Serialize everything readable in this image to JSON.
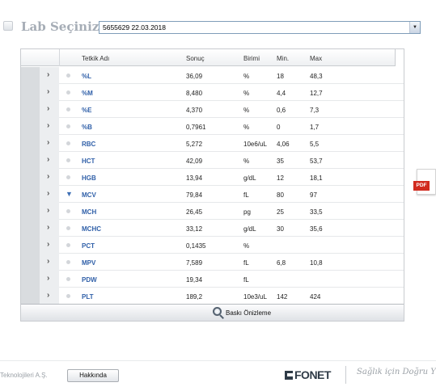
{
  "header": {
    "title": "Lab Seçiniz",
    "lab_value": "5655629 22.03.2018"
  },
  "table": {
    "columns": {
      "name": "Tetkik Adı",
      "result": "Sonuç",
      "unit": "Birimi",
      "min": "Min.",
      "max": "Max"
    },
    "rows": [
      {
        "name": "%L",
        "result": "36,09",
        "unit": "%",
        "min": "18",
        "max": "48,3",
        "flag": ""
      },
      {
        "name": "%M",
        "result": "8,480",
        "unit": "%",
        "min": "4,4",
        "max": "12,7",
        "flag": ""
      },
      {
        "name": "%E",
        "result": "4,370",
        "unit": "%",
        "min": "0,6",
        "max": "7,3",
        "flag": ""
      },
      {
        "name": "%B",
        "result": "0,7961",
        "unit": "%",
        "min": "0",
        "max": "1,7",
        "flag": ""
      },
      {
        "name": "RBC",
        "result": "5,272",
        "unit": "10e6/uL",
        "min": "4,06",
        "max": "5,5",
        "flag": ""
      },
      {
        "name": "HCT",
        "result": "42,09",
        "unit": "%",
        "min": "35",
        "max": "53,7",
        "flag": ""
      },
      {
        "name": "HGB",
        "result": "13,94",
        "unit": "g/dL",
        "min": "12",
        "max": "18,1",
        "flag": ""
      },
      {
        "name": "MCV",
        "result": "79,84",
        "unit": "fL",
        "min": "80",
        "max": "97",
        "flag": "low"
      },
      {
        "name": "MCH",
        "result": "26,45",
        "unit": "pg",
        "min": "25",
        "max": "33,5",
        "flag": ""
      },
      {
        "name": "MCHC",
        "result": "33,12",
        "unit": "g/dL",
        "min": "30",
        "max": "35,6",
        "flag": ""
      },
      {
        "name": "PCT",
        "result": "0,1435",
        "unit": "%",
        "min": "",
        "max": "",
        "flag": ""
      },
      {
        "name": "MPV",
        "result": "7,589",
        "unit": "fL",
        "min": "6,8",
        "max": "10,8",
        "flag": ""
      },
      {
        "name": "PDW",
        "result": "19,34",
        "unit": "fL",
        "min": "",
        "max": "",
        "flag": ""
      },
      {
        "name": "PLT",
        "result": "189,2",
        "unit": "10e3/uL",
        "min": "142",
        "max": "424",
        "flag": ""
      }
    ],
    "print_preview_label": "Baskı Önizleme"
  },
  "pdf_label": "PDF",
  "footer": {
    "company": "Teknolojileri A.Ş.",
    "about_label": "Hakkında",
    "brand": "FONET",
    "slogan": "Sağlık için Doğru Y"
  },
  "icons": {
    "expand": "chevron-right-icon",
    "abnormal": "triangle-down-icon",
    "print": "magnifier-icon",
    "pdf": "pdf-file-icon"
  },
  "colors": {
    "link_blue": "#2f5fa8",
    "flag_blue": "#3f6fb5",
    "pdf_red": "#d12b1f"
  }
}
